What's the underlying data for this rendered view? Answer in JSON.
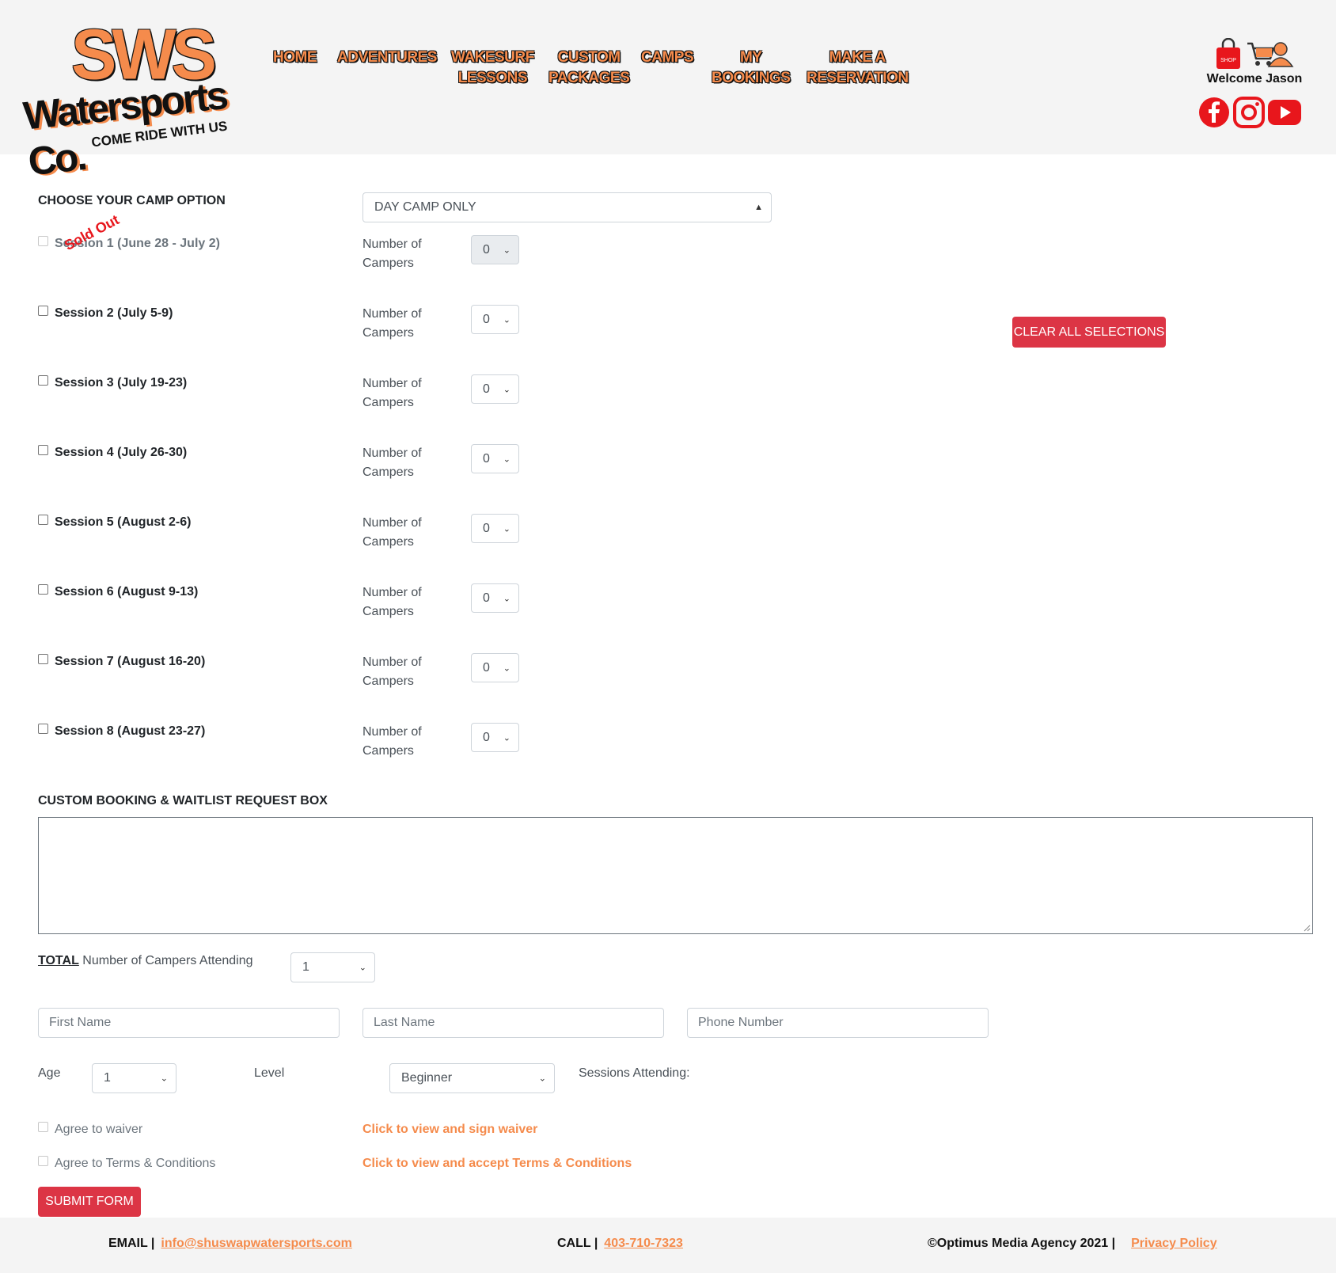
{
  "header": {
    "logo": {
      "main": "SWS",
      "sub": "Watersports Co.",
      "tagline": "COME RIDE WITH US"
    },
    "nav": [
      {
        "line1": "HOME",
        "line2": ""
      },
      {
        "line1": "ADVENTURES",
        "line2": ""
      },
      {
        "line1": "WAKESURF",
        "line2": "LESSONS"
      },
      {
        "line1": "CUSTOM",
        "line2": "PACKAGES"
      },
      {
        "line1": "CAMPS",
        "line2": ""
      },
      {
        "line1": "MY",
        "line2": "BOOKINGS"
      },
      {
        "line1": "MAKE A",
        "line2": "RESERVATION"
      }
    ],
    "shop_badge": "SHOP",
    "welcome": "Welcome Jason",
    "colors": {
      "brand_orange": "#f58b4c",
      "social_red": "#e8161c"
    }
  },
  "form": {
    "camp_option_label": "CHOOSE YOUR CAMP OPTION",
    "camp_option_value": "DAY CAMP ONLY",
    "sold_out_label": "Sold Out",
    "number_of_campers_label": "Number of Campers",
    "sessions": [
      {
        "label": "Session 1 (June 28 - July 2)",
        "campers": "0",
        "disabled": true
      },
      {
        "label": "Session 2 (July 5-9)",
        "campers": "0",
        "disabled": false
      },
      {
        "label": "Session 3 (July 19-23)",
        "campers": "0",
        "disabled": false
      },
      {
        "label": "Session 4 (July 26-30)",
        "campers": "0",
        "disabled": false
      },
      {
        "label": "Session 5 (August 2-6)",
        "campers": "0",
        "disabled": false
      },
      {
        "label": "Session 6 (August 9-13)",
        "campers": "0",
        "disabled": false
      },
      {
        "label": "Session 7 (August 16-20)",
        "campers": "0",
        "disabled": false
      },
      {
        "label": "Session 8 (August 23-27)",
        "campers": "0",
        "disabled": false
      }
    ],
    "clear_button": "CLEAR ALL SELECTIONS",
    "request_box_label": "CUSTOM BOOKING & WAITLIST REQUEST BOX",
    "total_label_bold": "TOTAL",
    "total_label_rest": "Number of Campers Attending",
    "total_value": "1",
    "first_name_placeholder": "First Name",
    "last_name_placeholder": "Last Name",
    "phone_placeholder": "Phone Number",
    "age_label": "Age",
    "age_value": "1",
    "level_label": "Level",
    "level_value": "Beginner",
    "sessions_attending_label": "Sessions Attending:",
    "waiver_label": "Agree to waiver",
    "waiver_link": "Click to view and sign waiver",
    "terms_label": "Agree to Terms & Conditions",
    "terms_link": "Click to view and accept Terms & Conditions",
    "submit_button": "SUBMIT FORM",
    "colors": {
      "button_red": "#dc3545"
    }
  },
  "footer": {
    "email_label": "EMAIL |",
    "email_value": "info@shuswapwatersports.com",
    "call_label": "CALL |",
    "call_value": "403-710-7323",
    "copyright": "©Optimus Media Agency 2021 |",
    "privacy": "Privacy Policy"
  }
}
